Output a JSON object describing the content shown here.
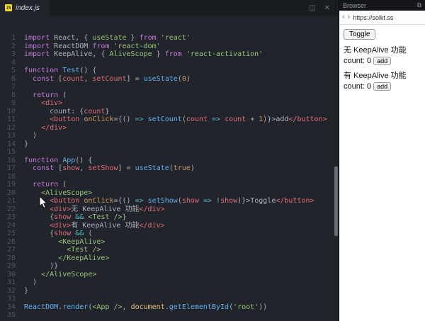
{
  "editor": {
    "tab_label": "index.js",
    "tab_icon": "JS",
    "icons": {
      "split_editor": "◫",
      "close": "✕"
    },
    "lines": [
      [
        [
          "kw",
          "import"
        ],
        [
          "pln",
          " React, { "
        ],
        [
          "cmp",
          "useState"
        ],
        [
          "pln",
          " } "
        ],
        [
          "kw",
          "from"
        ],
        [
          "pln",
          " "
        ],
        [
          "str",
          "'react'"
        ]
      ],
      [
        [
          "kw",
          "import"
        ],
        [
          "pln",
          " ReactDOM "
        ],
        [
          "kw",
          "from"
        ],
        [
          "pln",
          " "
        ],
        [
          "str",
          "'react-dom'"
        ]
      ],
      [
        [
          "kw",
          "import"
        ],
        [
          "pln",
          " KeepAlive, { "
        ],
        [
          "cmp",
          "AliveScope"
        ],
        [
          "pln",
          " } "
        ],
        [
          "kw",
          "from"
        ],
        [
          "pln",
          " "
        ],
        [
          "str",
          "'react-activation'"
        ]
      ],
      [],
      [
        [
          "kw",
          "function"
        ],
        [
          "pln",
          " "
        ],
        [
          "fn",
          "Test"
        ],
        [
          "pln",
          "() {"
        ]
      ],
      [
        [
          "pln",
          "  "
        ],
        [
          "kw",
          "const"
        ],
        [
          "pln",
          " ["
        ],
        [
          "var",
          "count"
        ],
        [
          "pln",
          ", "
        ],
        [
          "var",
          "setCount"
        ],
        [
          "pln",
          "] = "
        ],
        [
          "fn",
          "useState"
        ],
        [
          "pln",
          "("
        ],
        [
          "num",
          "0"
        ],
        [
          "pln",
          ")"
        ]
      ],
      [],
      [
        [
          "pln",
          "  "
        ],
        [
          "kw",
          "return"
        ],
        [
          "pln",
          " ("
        ]
      ],
      [
        [
          "pln",
          "    "
        ],
        [
          "tag",
          "<div>"
        ]
      ],
      [
        [
          "pln",
          "      count: {"
        ],
        [
          "var",
          "count"
        ],
        [
          "pln",
          "}"
        ]
      ],
      [
        [
          "pln",
          "      "
        ],
        [
          "tag",
          "<button"
        ],
        [
          "pln",
          " "
        ],
        [
          "attr",
          "onClick"
        ],
        [
          "pln",
          "={() "
        ],
        [
          "op",
          "=>"
        ],
        [
          "pln",
          " "
        ],
        [
          "fn",
          "setCount"
        ],
        [
          "pln",
          "("
        ],
        [
          "var",
          "count"
        ],
        [
          "pln",
          " "
        ],
        [
          "op",
          "=>"
        ],
        [
          "pln",
          " "
        ],
        [
          "var",
          "count"
        ],
        [
          "pln",
          " + "
        ],
        [
          "num",
          "1"
        ],
        [
          "pln",
          ")}>add"
        ],
        [
          "tag",
          "</button>"
        ]
      ],
      [
        [
          "pln",
          "    "
        ],
        [
          "tag",
          "</div>"
        ]
      ],
      [
        [
          "pln",
          "  )"
        ]
      ],
      [
        [
          "pln",
          "}"
        ]
      ],
      [],
      [
        [
          "kw",
          "function"
        ],
        [
          "pln",
          " "
        ],
        [
          "fn",
          "App"
        ],
        [
          "pln",
          "() {"
        ]
      ],
      [
        [
          "pln",
          "  "
        ],
        [
          "kw",
          "const"
        ],
        [
          "pln",
          " ["
        ],
        [
          "var",
          "show"
        ],
        [
          "pln",
          ", "
        ],
        [
          "var",
          "setShow"
        ],
        [
          "pln",
          "] = "
        ],
        [
          "fn",
          "useState"
        ],
        [
          "pln",
          "("
        ],
        [
          "num",
          "true"
        ],
        [
          "pln",
          ")"
        ]
      ],
      [],
      [
        [
          "pln",
          "  "
        ],
        [
          "kw",
          "return"
        ],
        [
          "pln",
          " ("
        ]
      ],
      [
        [
          "pln",
          "    "
        ],
        [
          "cmp",
          "<AliveScope>"
        ]
      ],
      [
        [
          "pln",
          "      "
        ],
        [
          "tag",
          "<button"
        ],
        [
          "pln",
          " "
        ],
        [
          "attr",
          "onClick"
        ],
        [
          "pln",
          "={() "
        ],
        [
          "op",
          "=>"
        ],
        [
          "pln",
          " "
        ],
        [
          "fn",
          "setShow"
        ],
        [
          "pln",
          "("
        ],
        [
          "var",
          "show"
        ],
        [
          "pln",
          " "
        ],
        [
          "op",
          "=>"
        ],
        [
          "pln",
          " "
        ],
        [
          "op",
          "!"
        ],
        [
          "var",
          "show"
        ],
        [
          "pln",
          ")}>Toggle"
        ],
        [
          "tag",
          "</button>"
        ]
      ],
      [
        [
          "pln",
          "      "
        ],
        [
          "tag",
          "<div>"
        ],
        [
          "pln",
          "无 KeepAlive 功能"
        ],
        [
          "tag",
          "</div>"
        ]
      ],
      [
        [
          "pln",
          "      {"
        ],
        [
          "var",
          "show"
        ],
        [
          "pln",
          " "
        ],
        [
          "op",
          "&&"
        ],
        [
          "pln",
          " "
        ],
        [
          "cmp",
          "<Test />"
        ],
        [
          "pln",
          "}"
        ]
      ],
      [
        [
          "pln",
          "      "
        ],
        [
          "tag",
          "<div>"
        ],
        [
          "pln",
          "有 KeepAlive 功能"
        ],
        [
          "tag",
          "</div>"
        ]
      ],
      [
        [
          "pln",
          "      {"
        ],
        [
          "var",
          "show"
        ],
        [
          "pln",
          " "
        ],
        [
          "op",
          "&&"
        ],
        [
          "pln",
          " ("
        ]
      ],
      [
        [
          "pln",
          "        "
        ],
        [
          "cmp",
          "<KeepAlive>"
        ]
      ],
      [
        [
          "pln",
          "          "
        ],
        [
          "cmp",
          "<Test />"
        ]
      ],
      [
        [
          "pln",
          "        "
        ],
        [
          "cmp",
          "</KeepAlive>"
        ]
      ],
      [
        [
          "pln",
          "      )}"
        ]
      ],
      [
        [
          "pln",
          "    "
        ],
        [
          "cmp",
          "</AliveScope>"
        ]
      ],
      [
        [
          "pln",
          "  )"
        ]
      ],
      [
        [
          "pln",
          "}"
        ]
      ],
      [],
      [
        [
          "fn",
          "ReactDOM"
        ],
        [
          "pln",
          "."
        ],
        [
          "fn",
          "render"
        ],
        [
          "pln",
          "("
        ],
        [
          "cmp",
          "<App />"
        ],
        [
          "pln",
          ", "
        ],
        [
          "sup",
          "document"
        ],
        [
          "pln",
          "."
        ],
        [
          "fn",
          "getElementById"
        ],
        [
          "pln",
          "("
        ],
        [
          "str",
          "'root'"
        ],
        [
          "pln",
          "))"
        ]
      ],
      []
    ]
  },
  "browser": {
    "title": "Browser",
    "url": "https://solkt.ss",
    "nav": {
      "back": "‹",
      "forward": "›"
    },
    "icons": {
      "open_external": "⧉"
    },
    "page": {
      "toggle_button": "Toggle",
      "sections": [
        {
          "heading": "无 KeepAlive 功能",
          "count": "count: 0",
          "add_button": "add"
        },
        {
          "heading": "有 KeepAlive 功能",
          "count": "count: 0",
          "add_button": "add"
        }
      ]
    }
  }
}
